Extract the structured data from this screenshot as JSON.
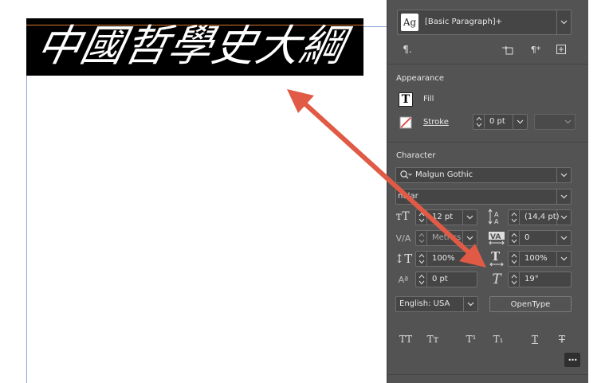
{
  "document": {
    "headline": "中國哲學史大綱"
  },
  "panel": {
    "paragraph_style": {
      "swatch": "Ag",
      "value": "[Basic Paragraph]+"
    },
    "appearance": {
      "title": "Appearance",
      "fill_label": "Fill",
      "stroke_label": "Stroke",
      "stroke_weight": "0 pt"
    },
    "character": {
      "title": "Character",
      "font_family": "Malgun Gothic",
      "font_style": "nular",
      "font_size": "12 pt",
      "leading": "(14,4 pt)",
      "kerning": "Metrics",
      "tracking": "0",
      "vertical_scale": "100%",
      "horizontal_scale": "100%",
      "baseline_shift": "0 pt",
      "skew": "19°",
      "language": "English: USA",
      "opentype_label": "OpenType"
    },
    "type_buttons": [
      "TT",
      "Tт",
      "T¹",
      "T₁",
      "T",
      "T"
    ],
    "more_label": "•••"
  },
  "colors": {
    "panel_bg": "#535353",
    "field_bg": "#454545",
    "arrow": "#e05a45",
    "guide": "#8aa6d6",
    "baseline": "#d9772e",
    "spell_check": "#49c2d9"
  }
}
